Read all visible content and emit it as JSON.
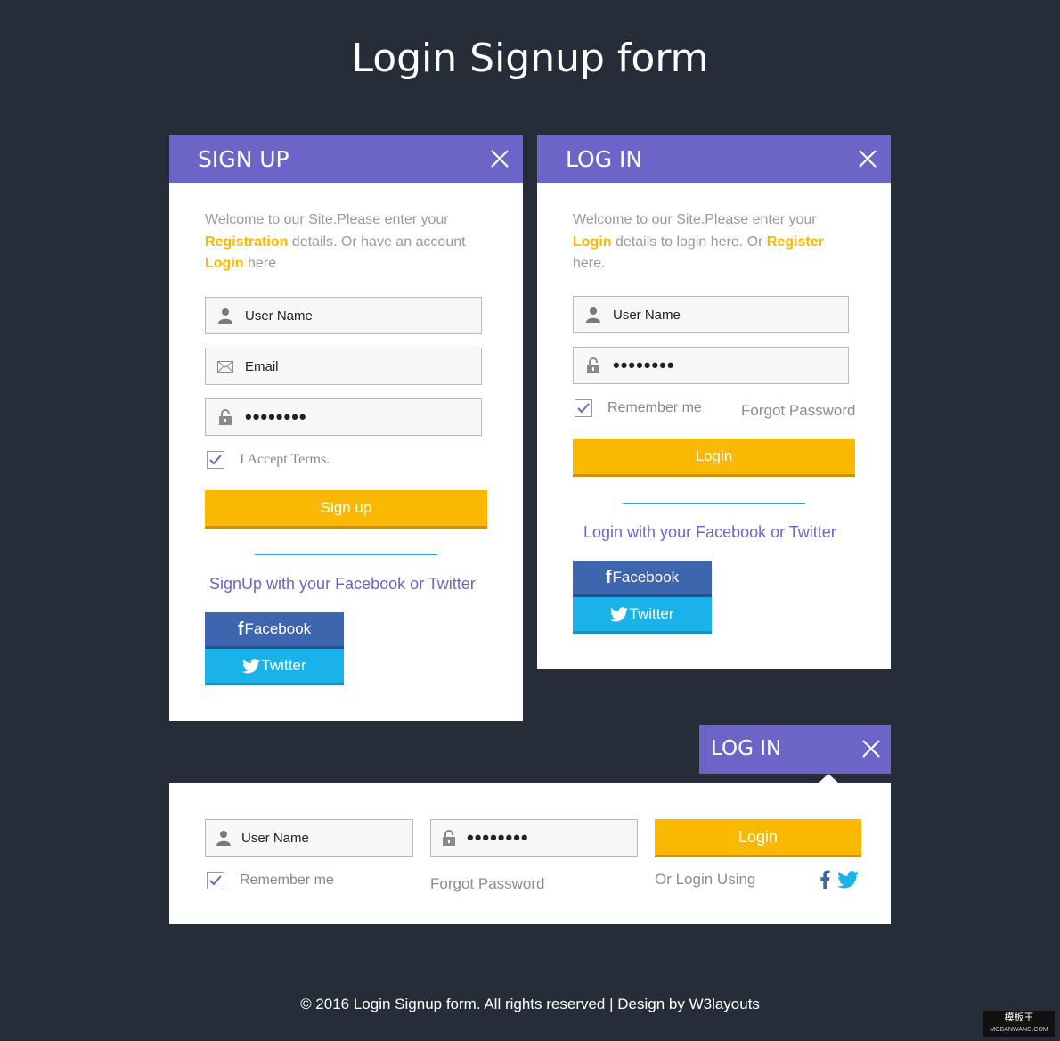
{
  "page_title": "Login Signup form",
  "signup": {
    "header": "SIGN UP",
    "intro_pre": "Welcome to our Site.Please enter your ",
    "intro_hl1": "Registration",
    "intro_mid": " details. Or have an account ",
    "intro_hl2": "Login",
    "intro_post": " here",
    "username_placeholder": "User Name",
    "email_placeholder": "Email",
    "password_value": "••••••••",
    "terms_label": "I Accept Terms.",
    "submit_label": "Sign up",
    "social_text": "SignUp with your Facebook or Twitter",
    "facebook_label": "Facebook",
    "twitter_label": "Twitter"
  },
  "login": {
    "header": "LOG IN",
    "intro_pre": "Welcome to our Site.Please enter your ",
    "intro_hl1": "Login",
    "intro_mid": " details to login here. Or ",
    "intro_hl2": "Register",
    "intro_post": " here.",
    "username_placeholder": "User Name",
    "password_value": "••••••••",
    "remember_label": "Remember me",
    "forgot_label": "Forgot Password",
    "submit_label": "Login",
    "social_text": "Login with your Facebook or Twitter",
    "facebook_label": "Facebook",
    "twitter_label": "Twitter"
  },
  "inline_login": {
    "header": "LOG IN",
    "username_placeholder": "User Name",
    "password_value": "••••••••",
    "submit_label": "Login",
    "remember_label": "Remember me",
    "forgot_label": "Forgot Password",
    "or_login_using": "Or Login Using"
  },
  "footer": "© 2016 Login Signup form. All rights reserved | Design by W3layouts",
  "watermark": {
    "line1": "模板王",
    "line2": "MOBANWANG.COM"
  },
  "icons": {
    "close": "close-icon",
    "user": "user-icon",
    "email": "envelope-icon",
    "lock": "lock-icon",
    "check": "check-icon",
    "facebook": "facebook-icon",
    "twitter": "twitter-icon"
  },
  "colors": {
    "background": "#252d38",
    "header": "#6b65c8",
    "accent_yellow": "#fbb800",
    "facebook": "#3d66ae",
    "twitter": "#1ab2e8",
    "link_purple": "#6b65c8"
  }
}
